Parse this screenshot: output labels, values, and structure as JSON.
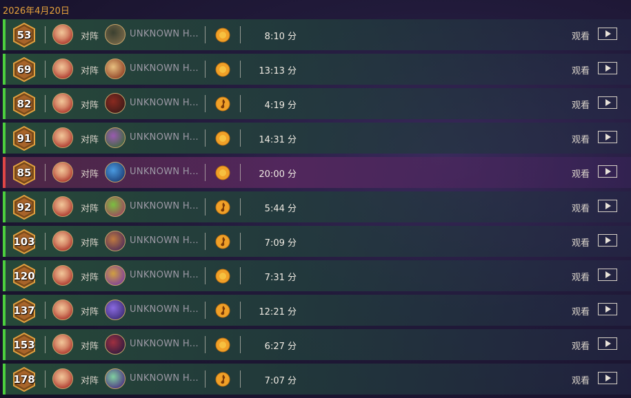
{
  "date": "2026年4月20日",
  "labels": {
    "vs": "对阵",
    "watch": "观看"
  },
  "colors": {
    "win_border": "#4ccf3e",
    "loss_border": "#e04646",
    "accent": "#e8a33c",
    "coin": "#f0a028"
  },
  "matches": [
    {
      "rating": "53",
      "outcome": "win",
      "opponent": "UNKNOWN H...",
      "result_icon": "coin-icon",
      "duration": "8:10 分",
      "opp_colors": [
        "#3b4030",
        "#7a6a4a"
      ]
    },
    {
      "rating": "69",
      "outcome": "win",
      "opponent": "UNKNOWN H...",
      "result_icon": "coin-icon",
      "duration": "13:13 分",
      "opp_colors": [
        "#e8c080",
        "#8a3a20"
      ]
    },
    {
      "rating": "82",
      "outcome": "win",
      "opponent": "UNKNOWN H...",
      "result_icon": "flame-icon",
      "duration": "4:19 分",
      "opp_colors": [
        "#8a2a20",
        "#3a1a18"
      ]
    },
    {
      "rating": "91",
      "outcome": "win",
      "opponent": "UNKNOWN H...",
      "result_icon": "coin-icon",
      "duration": "14:31 分",
      "opp_colors": [
        "#9a5ab0",
        "#3a6a3a"
      ]
    },
    {
      "rating": "85",
      "outcome": "loss",
      "opponent": "UNKNOWN H...",
      "result_icon": "coin-icon",
      "duration": "20:00 分",
      "opp_colors": [
        "#4a9ae0",
        "#1a3a70"
      ]
    },
    {
      "rating": "92",
      "outcome": "win",
      "opponent": "UNKNOWN H...",
      "result_icon": "flame-icon",
      "duration": "5:44 分",
      "opp_colors": [
        "#7ac040",
        "#a04060"
      ]
    },
    {
      "rating": "103",
      "outcome": "win",
      "opponent": "UNKNOWN H...",
      "result_icon": "flame-icon",
      "duration": "7:09 分",
      "opp_colors": [
        "#c07a40",
        "#4a2a5a"
      ]
    },
    {
      "rating": "120",
      "outcome": "win",
      "opponent": "UNKNOWN H...",
      "result_icon": "coin-icon",
      "duration": "7:31 分",
      "opp_colors": [
        "#d0a040",
        "#7a3aa0"
      ]
    },
    {
      "rating": "137",
      "outcome": "win",
      "opponent": "UNKNOWN H...",
      "result_icon": "flame-icon",
      "duration": "12:21 分",
      "opp_colors": [
        "#8a6ae0",
        "#3a2a70"
      ]
    },
    {
      "rating": "153",
      "outcome": "win",
      "opponent": "UNKNOWN H...",
      "result_icon": "coin-icon",
      "duration": "6:27 分",
      "opp_colors": [
        "#a03040",
        "#2a1a40"
      ]
    },
    {
      "rating": "178",
      "outcome": "win",
      "opponent": "UNKNOWN H...",
      "result_icon": "flame-icon",
      "duration": "7:07 分",
      "opp_colors": [
        "#80d0a0",
        "#4a2a80"
      ]
    }
  ]
}
